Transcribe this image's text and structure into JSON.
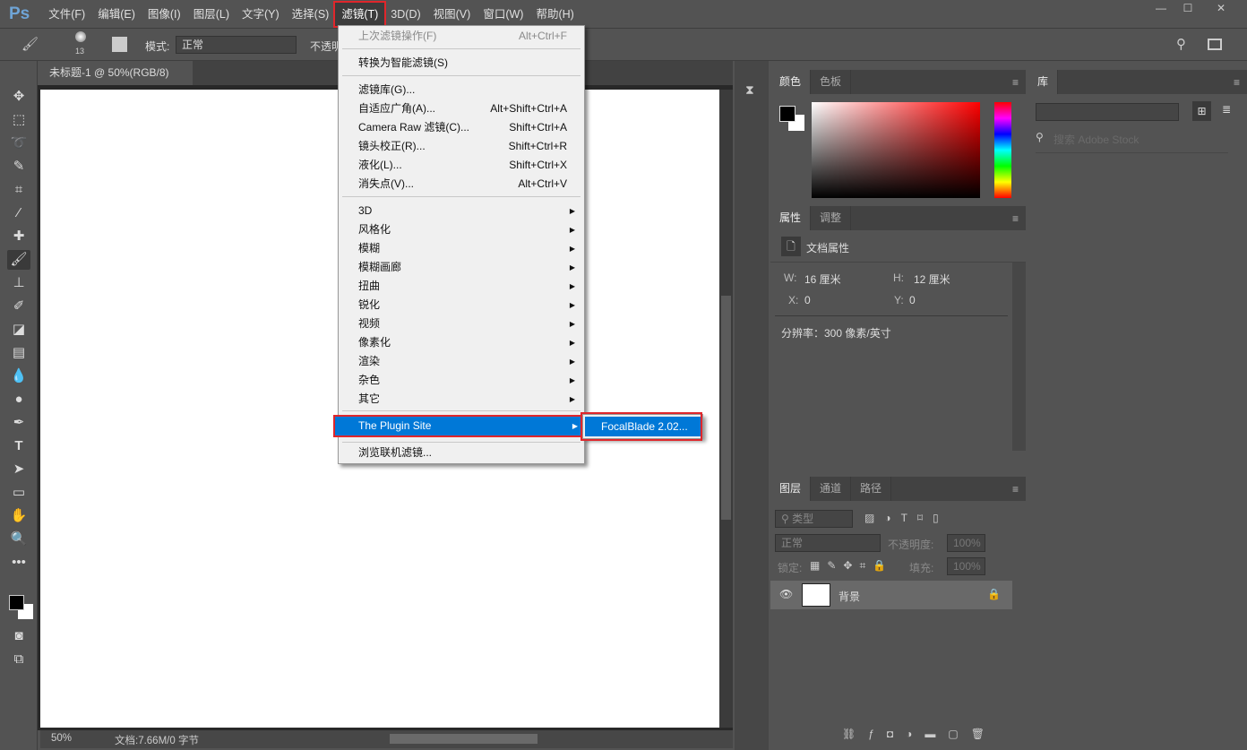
{
  "app": {
    "logo": "Ps"
  },
  "menubar": [
    "文件(F)",
    "编辑(E)",
    "图像(I)",
    "图层(L)",
    "文字(Y)",
    "选择(S)",
    "滤镜(T)",
    "3D(D)",
    "视图(V)",
    "窗口(W)",
    "帮助(H)"
  ],
  "window_controls": [
    "—",
    "☐",
    "✕"
  ],
  "options": {
    "brush_size": "13",
    "mode_label": "模式:",
    "mode_value": "正常",
    "opacity_label": "不透明"
  },
  "document": {
    "tab_title": "未标题-1 @ 50%(RGB/8)",
    "close": "×",
    "zoom": "50%",
    "doc_info": "文档:7.66M/0 字节"
  },
  "filter_menu": {
    "last_filter": {
      "label": "上次滤镜操作(F)",
      "shortcut": "Alt+Ctrl+F"
    },
    "smart": "转换为智能滤镜(S)",
    "group1": [
      {
        "label": "滤镜库(G)...",
        "shortcut": ""
      },
      {
        "label": "自适应广角(A)...",
        "shortcut": "Alt+Shift+Ctrl+A"
      },
      {
        "label": "Camera Raw 滤镜(C)...",
        "shortcut": "Shift+Ctrl+A"
      },
      {
        "label": "镜头校正(R)...",
        "shortcut": "Shift+Ctrl+R"
      },
      {
        "label": "液化(L)...",
        "shortcut": "Shift+Ctrl+X"
      },
      {
        "label": "消失点(V)...",
        "shortcut": "Alt+Ctrl+V"
      }
    ],
    "submenus": [
      "3D",
      "风格化",
      "模糊",
      "模糊画廊",
      "扭曲",
      "锐化",
      "视频",
      "像素化",
      "渲染",
      "杂色",
      "其它"
    ],
    "plugin": "The Plugin Site",
    "browse": "浏览联机滤镜..."
  },
  "plugin_submenu": {
    "item": "FocalBlade 2.02..."
  },
  "color_panel": {
    "tabs": [
      "颜色",
      "色板"
    ],
    "accent": "#ff0000"
  },
  "properties_panel": {
    "tabs": [
      "属性",
      "调整"
    ],
    "title": "文档属性",
    "w_label": "W:",
    "w": "16 厘米",
    "h_label": "H:",
    "h": "12 厘米",
    "x_label": "X:",
    "x": "0",
    "y_label": "Y:",
    "y": "0",
    "resolution": "分辨率：300 像素/英寸"
  },
  "layers_panel": {
    "tabs": [
      "图层",
      "通道",
      "路径"
    ],
    "filter": "类型",
    "blend": "正常",
    "opacity_label": "不透明度:",
    "opacity": "100%",
    "lock_label": "锁定:",
    "fill_label": "填充:",
    "fill": "100%",
    "layer_name": "背景"
  },
  "library_panel": {
    "tab": "库",
    "search_placeholder": "搜索 Adobe Stock"
  }
}
